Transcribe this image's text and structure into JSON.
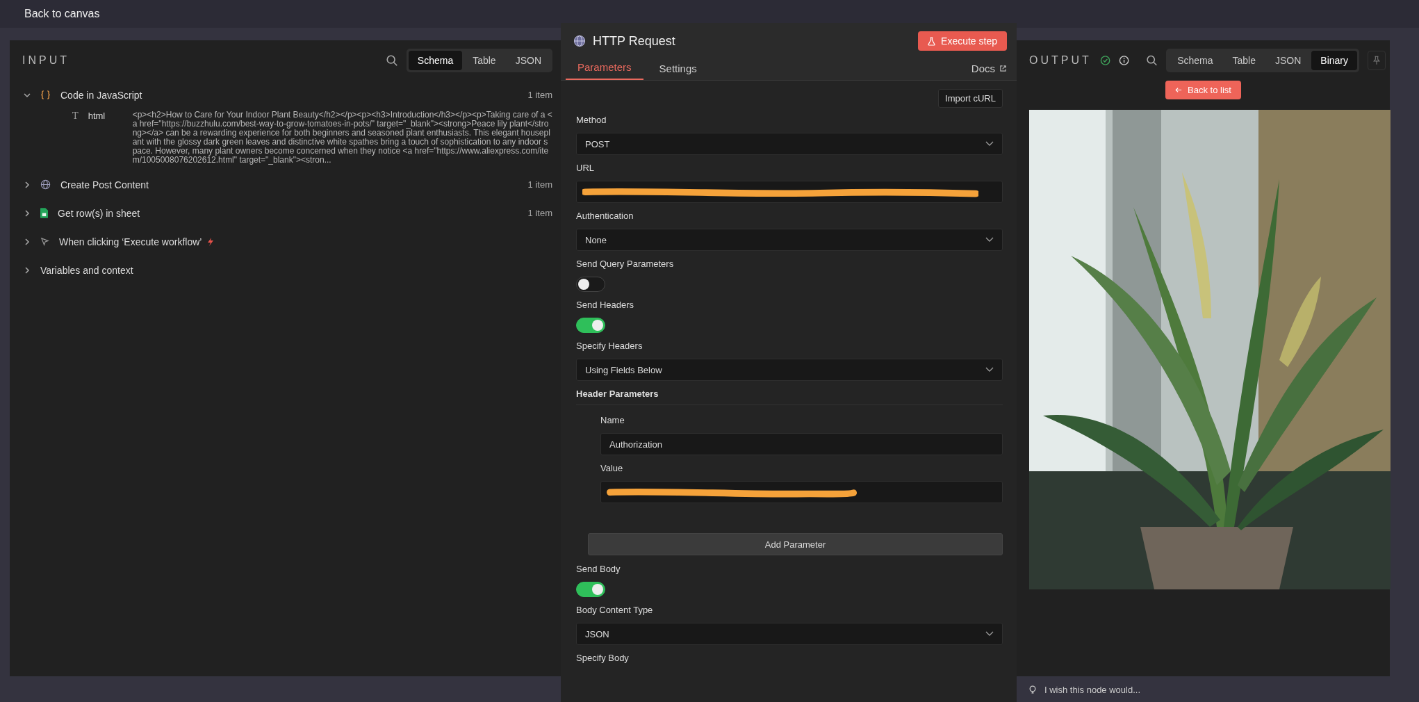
{
  "top_bar": {
    "back_label": "Back to canvas"
  },
  "input_panel": {
    "title": "INPUT",
    "view_tabs": [
      {
        "label": "Schema",
        "selected": true
      },
      {
        "label": "Table",
        "selected": false
      },
      {
        "label": "JSON",
        "selected": false
      }
    ],
    "nodes": [
      {
        "name": "Code in JavaScript",
        "kind": "code",
        "count": "1 item",
        "expanded": true,
        "fields": [
          {
            "type_icon": "T",
            "key": "html",
            "value": "<p><h2>How to Care for Your Indoor Plant Beauty</h2></p><p><h3>Introduction</h3></p><p>Taking care of a <a href=\"https://buzzhulu.com/best-way-to-grow-tomatoes-in-pots/\" target=\"_blank\"><strong>Peace lily plant</strong></a> can be a rewarding experience for both beginners and seasoned plant enthusiasts. This elegant houseplant with the glossy dark green leaves and distinctive white spathes bring a touch of sophistication to any indoor space. However, many plant owners become concerned when they notice <a href=\"https://www.aliexpress.com/item/1005008076202612.html\" target=\"_blank\"><stron..."
          }
        ]
      },
      {
        "name": "Create Post Content",
        "kind": "http",
        "count": "1 item",
        "expanded": false
      },
      {
        "name": "Get row(s) in sheet",
        "kind": "sheet",
        "count": "1 item",
        "expanded": false
      },
      {
        "name": "When clicking ‘Execute workflow’",
        "kind": "trigger",
        "expanded": false
      }
    ],
    "variables": {
      "label": "Variables and context",
      "expanded": false
    }
  },
  "node_panel": {
    "title": "HTTP Request",
    "execute_button": "Execute step",
    "tabs": [
      {
        "label": "Parameters",
        "selected": true
      },
      {
        "label": "Settings",
        "selected": false
      }
    ],
    "docs_link": "Docs",
    "import_button": "Import cURL",
    "params": [
      {
        "kind": "select",
        "label": "Method",
        "value": "POST"
      },
      {
        "kind": "input",
        "label": "URL",
        "redacted": true
      },
      {
        "kind": "select",
        "label": "Authentication",
        "value": "None"
      },
      {
        "kind": "toggle",
        "label": "Send Query Parameters",
        "on": false
      },
      {
        "kind": "toggle",
        "label": "Send Headers",
        "on": true
      },
      {
        "kind": "select",
        "label": "Specify Headers",
        "value": "Using Fields Below"
      },
      {
        "kind": "group",
        "label": "Header Parameters",
        "add_button": "Add Parameter",
        "items": [
          {
            "kind": "input",
            "label": "Name",
            "value": "Authorization"
          },
          {
            "kind": "input",
            "label": "Value",
            "redacted": true
          }
        ]
      },
      {
        "kind": "toggle",
        "label": "Send Body",
        "on": true
      },
      {
        "kind": "select",
        "label": "Body Content Type",
        "value": "JSON"
      },
      {
        "kind": "heading",
        "label": "Specify Body"
      }
    ]
  },
  "output_panel": {
    "title": "OUTPUT",
    "view_tabs": [
      {
        "label": "Schema",
        "selected": false
      },
      {
        "label": "Table",
        "selected": false
      },
      {
        "label": "JSON",
        "selected": false
      },
      {
        "label": "Binary",
        "selected": true
      }
    ],
    "back_button": "Back to list"
  },
  "footer": {
    "feedback": "I wish this node would..."
  }
}
